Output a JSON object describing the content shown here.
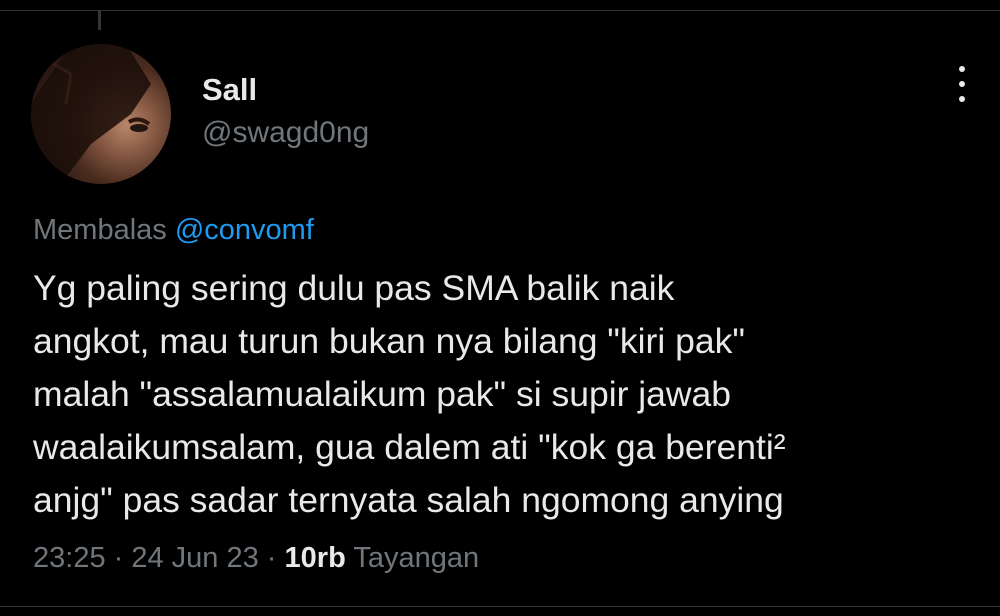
{
  "user": {
    "name": "Sall",
    "handle": "@swagd0ng"
  },
  "reply": {
    "prefix": "Membalas ",
    "mention": "@convomf"
  },
  "tweet": {
    "lines": [
      "Yg paling sering dulu pas SMA balik naik",
      "angkot, mau turun bukan nya bilang \"kiri pak\"",
      "malah \"assalamualaikum pak\" si supir jawab",
      "waalaikumsalam, gua dalem ati \"kok ga berenti²",
      "anjg\" pas sadar ternyata salah ngomong anying"
    ]
  },
  "meta": {
    "time": "23:25",
    "sep1": " · ",
    "date": "24 Jun 23",
    "sep2": " · ",
    "views_count": "10rb",
    "views_label": " Tayangan"
  },
  "icons": {
    "more": "more-vertical-icon"
  },
  "colors": {
    "background": "#000000",
    "text_primary": "#e7e9ea",
    "text_secondary": "#71767b",
    "accent": "#1d9bf0",
    "divider": "#2f3336"
  }
}
